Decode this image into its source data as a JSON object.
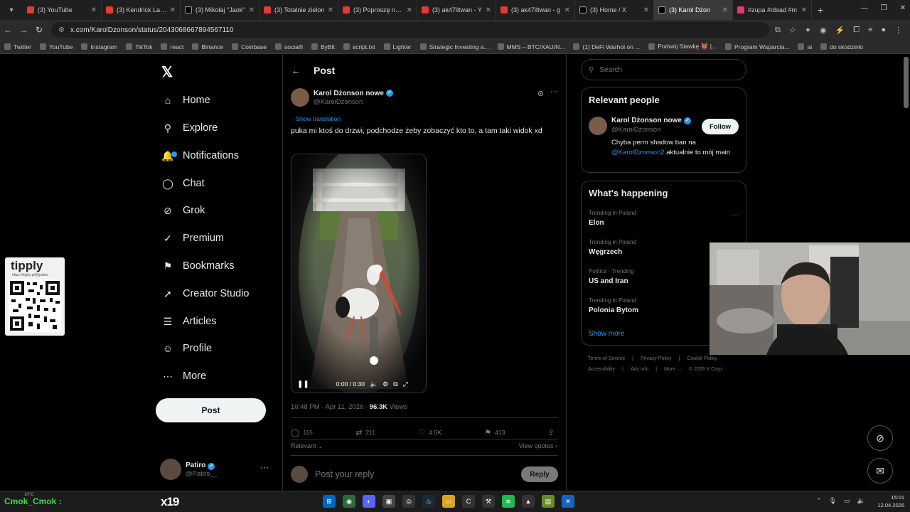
{
  "browser": {
    "tabs": [
      {
        "label": "(3) YouTube",
        "fav": "yt",
        "active": false
      },
      {
        "label": "(3) Kendrick Lama",
        "fav": "yt",
        "active": false
      },
      {
        "label": "(3) Mikołaj \"Jaok\"",
        "fav": "x",
        "active": false
      },
      {
        "label": "(3) Totalnie zielon",
        "fav": "yt",
        "active": false
      },
      {
        "label": "(3) Poproszę na s",
        "fav": "yt",
        "active": false
      },
      {
        "label": "(3) ak47iltwan - Y",
        "fav": "yt",
        "active": false
      },
      {
        "label": "(3) ak47iltwan - g",
        "fav": "yt",
        "active": false
      },
      {
        "label": "(3) Home / X",
        "fav": "x",
        "active": false
      },
      {
        "label": "(3) Karol Dżon",
        "fav": "x",
        "active": true
      },
      {
        "label": "#zupa #obiad #m",
        "fav": "ig",
        "active": false
      }
    ],
    "url": "x.com/KarolDzonson/status/2043068667894567110",
    "bookmarks": [
      "Twitter",
      "YouTube",
      "Instagram",
      "TikTok",
      "react",
      "Binance",
      "Coinbase",
      "socialfi",
      "ByBit",
      "script.txt",
      "Lighter",
      "Strategic Investing a...",
      "MMS – BTC/XAU/N...",
      "(1) DeFi Warhol on ...",
      "Podwój Stawkę 👹 |...",
      "Program Wsparcia...",
      "ai",
      "do skodzinki"
    ]
  },
  "nav": {
    "items": [
      {
        "label": "Home",
        "icon": "home-icon",
        "glyph": "⌂"
      },
      {
        "label": "Explore",
        "icon": "search-icon",
        "glyph": "⚲"
      },
      {
        "label": "Notifications",
        "icon": "bell-icon",
        "glyph": "🔔"
      },
      {
        "label": "Chat",
        "icon": "chat-icon",
        "glyph": "◯"
      },
      {
        "label": "Grok",
        "icon": "grok-icon",
        "glyph": "⊘"
      },
      {
        "label": "Premium",
        "icon": "premium-icon",
        "glyph": "✓"
      },
      {
        "label": "Bookmarks",
        "icon": "bookmark-icon",
        "glyph": "⚑"
      },
      {
        "label": "Creator Studio",
        "icon": "rocket-icon",
        "glyph": "➚"
      },
      {
        "label": "Articles",
        "icon": "article-icon",
        "glyph": "☰"
      },
      {
        "label": "Profile",
        "icon": "person-icon",
        "glyph": "☺"
      },
      {
        "label": "More",
        "icon": "more-circle-icon",
        "glyph": "⋯"
      }
    ],
    "post_button": "Post",
    "account": {
      "name": "Patiro",
      "handle": "@Patiro__"
    }
  },
  "post": {
    "header": "Post",
    "author": {
      "name": "Karol Dżonson nowe",
      "handle": "@KarolDzonson"
    },
    "show_translation": "Show translation",
    "text": "puka mi ktoś do drzwi, podchodze żeby zobaczyć kto to, a tam taki widok xd",
    "video_time": "0:00 / 0:30",
    "timestamp": "10:48 PM · Apr 11, 2026 · ",
    "views_count": "96.3K",
    "views_label": " Views",
    "stats": {
      "replies": "115",
      "reposts": "211",
      "likes": "4.5K",
      "bookmarks": "413"
    },
    "relevant": "Relevant",
    "view_quotes": "View quotes",
    "reply_placeholder": "Post your reply",
    "reply_button": "Reply"
  },
  "sidebar": {
    "search_placeholder": "Search",
    "relevant_people_title": "Relevant people",
    "person": {
      "name": "Karol Dżonson nowe",
      "handle": "@KarolDzonson",
      "follow": "Follow",
      "bio_pre": "Chyba perm shadow ban na ",
      "bio_mention": "@KarolDzonson2",
      "bio_post": " aktualnie to mój main"
    },
    "happening_title": "What's happening",
    "trends": [
      {
        "context": "Trending in Poland",
        "title": "Elon"
      },
      {
        "context": "Trending in Poland",
        "title": "Węgrzech"
      },
      {
        "context": "Politics · Trending",
        "title": "US and Iran"
      },
      {
        "context": "Trending in Poland",
        "title": "Polonia Bytom"
      }
    ],
    "show_more": "Show more",
    "footer": [
      "Terms of Service",
      "|",
      "Privacy Policy",
      "|",
      "Cookie Policy",
      "|",
      "Accessibility",
      "|",
      "Ads info",
      "|",
      "More ···",
      "© 2026 X Corp."
    ]
  },
  "overlay": {
    "tipply_logo": "tipply",
    "tipply_url": "https://tipply.pl/@patiro",
    "cmok_tag": "Cmok_Cmok :",
    "temp": "10°C",
    "x19": "x19"
  },
  "taskbar": {
    "time": "15:01",
    "date": "12.04.2026"
  },
  "colors": {
    "accent": "#1d9bf0",
    "background": "#000000",
    "border": "#2f3336",
    "muted": "#71767b"
  }
}
